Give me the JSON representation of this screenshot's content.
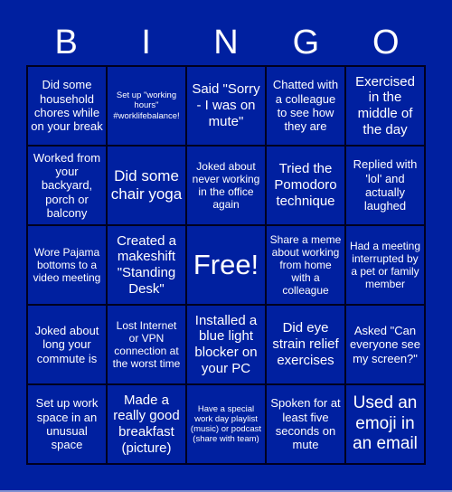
{
  "header": {
    "letters": [
      "B",
      "I",
      "N",
      "G",
      "O"
    ]
  },
  "colors": {
    "background": "#0020a0",
    "text": "#ffffff",
    "grid_line": "#000020"
  },
  "board": {
    "cells": [
      "Did some household chores while on your break",
      "Set up \"working hours\" #worklifebalance!",
      "Said \"Sorry - I was on mute\"",
      "Chatted with a colleague to see how they are",
      "Exercised in the middle of the day",
      "Worked from your backyard, porch or balcony",
      "Did some chair yoga",
      "Joked about never working in the office again",
      "Tried the Pomodoro technique",
      "Replied with 'lol' and actually laughed",
      "Wore Pajama bottoms to a video meeting",
      "Created a makeshift \"Standing Desk\"",
      "Free!",
      "Share a meme about working from home with a colleague",
      "Had a meeting interrupted by a pet or family member",
      "Joked about long your commute is",
      "Lost Internet or VPN connection at the worst time",
      "Installed a blue light blocker on your PC",
      "Did eye strain relief exercises",
      "Asked \"Can everyone see my screen?\"",
      "Set up work space in an unusual space",
      "Made a really good breakfast (picture)",
      "Have a special work day playlist (music) or podcast (share with team)",
      "Spoken for at least five seconds on mute",
      "Used an emoji in an email"
    ]
  }
}
